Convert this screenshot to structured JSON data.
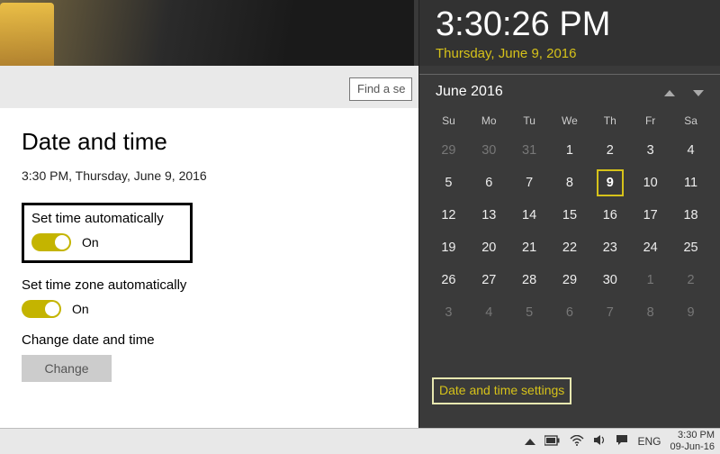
{
  "search": {
    "placeholder": "Find a se"
  },
  "settings": {
    "title": "Date and time",
    "now": "3:30 PM, Thursday, June 9, 2016",
    "auto_time": {
      "label": "Set time automatically",
      "state": "On"
    },
    "auto_tz": {
      "label": "Set time zone automatically",
      "state": "On"
    },
    "change": {
      "label": "Change date and time",
      "button": "Change"
    }
  },
  "flyout": {
    "time": "3:30:26 PM",
    "date": "Thursday, June 9, 2016",
    "month": "June 2016",
    "dow": [
      "Su",
      "Mo",
      "Tu",
      "We",
      "Th",
      "Fr",
      "Sa"
    ],
    "weeks": [
      [
        {
          "n": 29,
          "dim": true
        },
        {
          "n": 30,
          "dim": true
        },
        {
          "n": 31,
          "dim": true
        },
        {
          "n": 1
        },
        {
          "n": 2
        },
        {
          "n": 3
        },
        {
          "n": 4
        }
      ],
      [
        {
          "n": 5
        },
        {
          "n": 6
        },
        {
          "n": 7
        },
        {
          "n": 8
        },
        {
          "n": 9,
          "today": true
        },
        {
          "n": 10
        },
        {
          "n": 11
        }
      ],
      [
        {
          "n": 12
        },
        {
          "n": 13
        },
        {
          "n": 14
        },
        {
          "n": 15
        },
        {
          "n": 16
        },
        {
          "n": 17
        },
        {
          "n": 18
        }
      ],
      [
        {
          "n": 19
        },
        {
          "n": 20
        },
        {
          "n": 21
        },
        {
          "n": 22
        },
        {
          "n": 23
        },
        {
          "n": 24
        },
        {
          "n": 25
        }
      ],
      [
        {
          "n": 26
        },
        {
          "n": 27
        },
        {
          "n": 28
        },
        {
          "n": 29
        },
        {
          "n": 30
        },
        {
          "n": 1,
          "dim": true
        },
        {
          "n": 2,
          "dim": true
        }
      ],
      [
        {
          "n": 3,
          "dim": true
        },
        {
          "n": 4,
          "dim": true
        },
        {
          "n": 5,
          "dim": true
        },
        {
          "n": 6,
          "dim": true
        },
        {
          "n": 7,
          "dim": true
        },
        {
          "n": 8,
          "dim": true
        },
        {
          "n": 9,
          "dim": true
        }
      ]
    ],
    "link": "Date and time settings"
  },
  "taskbar": {
    "lang": "ENG",
    "time": "3:30 PM",
    "date": "09-Jun-16"
  }
}
